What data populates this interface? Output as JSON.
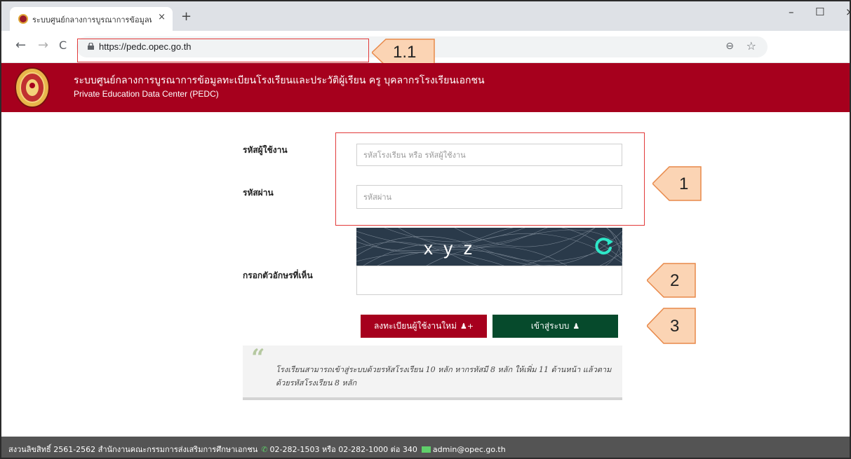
{
  "browser": {
    "tab_title": "ระบบศูนย์กลางการบูรณาการข้อมูลทะเบี",
    "tab_close": "×",
    "new_tab": "+",
    "window_controls": {
      "minimize": "–",
      "maximize": "☐",
      "close": "×"
    },
    "url": "https://pedc.opec.go.th"
  },
  "annotations": {
    "url_callout": "1.1",
    "login_callout": "1",
    "captcha_callout": "2",
    "buttons_callout": "3"
  },
  "header": {
    "title": "ระบบศูนย์กลางการบูรณาการข้อมูลทะเบียนโรงเรียนและประวัติผู้เรียน ครู บุคลากรโรงเรียนเอกชน",
    "subtitle": "Private Education Data Center (PEDC)"
  },
  "form": {
    "username_label": "รหัสผู้ใช้งาน",
    "username_placeholder": "รหัสโรงเรียน หรือ รหัสผู้ใช้งาน",
    "password_label": "รหัสผ่าน",
    "password_placeholder": "รหัสผ่าน",
    "captcha_label": "กรอกตัวอักษรที่เห็น",
    "captcha_text": "x y z",
    "register_button": "ลงทะเบียนผู้ใช้งานใหม่",
    "login_button": "เข้าสู่ระบบ"
  },
  "note": {
    "text": "โรงเรียนสามารถเข้าสู่ระบบด้วยรหัสโรงเรียน 10 หลัก หากรหัสมี 8 หลัก ให้เพิ่ม 11 ด้านหน้า แล้วตามด้วยรหัสโรงเรียน 8 หลัก"
  },
  "footer": {
    "copyright": "สงวนลิขสิทธิ์ 2561-2562 สำนักงานคณะกรรมการส่งเสริมการศึกษาเอกชน",
    "phone": "02-282-1503 หรือ 02-282-1000 ต่อ 340",
    "email": "admin@opec.go.th"
  },
  "colors": {
    "brand_red": "#a6001d",
    "brand_green": "#064a2c",
    "annotation_red": "#e23a3a",
    "callout_fill": "#fbd4b4"
  },
  "icons": [
    "favicon-icon",
    "back-arrow-icon",
    "forward-arrow-icon",
    "reload-icon",
    "lock-icon",
    "zoom-icon",
    "star-icon",
    "emblem-logo",
    "refresh-icon",
    "add-user-icon",
    "user-icon",
    "quote-icon",
    "phone-icon",
    "mail-icon"
  ]
}
